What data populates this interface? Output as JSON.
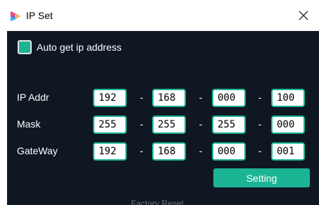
{
  "window": {
    "title": "IP Set",
    "close_icon": "close-icon",
    "app_icon": "app-logo-icon"
  },
  "auto_ip": {
    "label": "Auto get ip address",
    "checked": false
  },
  "rows": [
    {
      "label": "IP Addr",
      "octets": [
        "192",
        "168",
        "000",
        "100"
      ]
    },
    {
      "label": "Mask",
      "octets": [
        "255",
        "255",
        "255",
        "000"
      ]
    },
    {
      "label": "GateWay",
      "octets": [
        "192",
        "168",
        "000",
        "001"
      ]
    }
  ],
  "separator": "-",
  "buttons": {
    "setting": "Setting",
    "factory_reset": "Factory Reset"
  },
  "colors": {
    "accent": "#1bb596",
    "panel_bg": "#0f1723"
  }
}
